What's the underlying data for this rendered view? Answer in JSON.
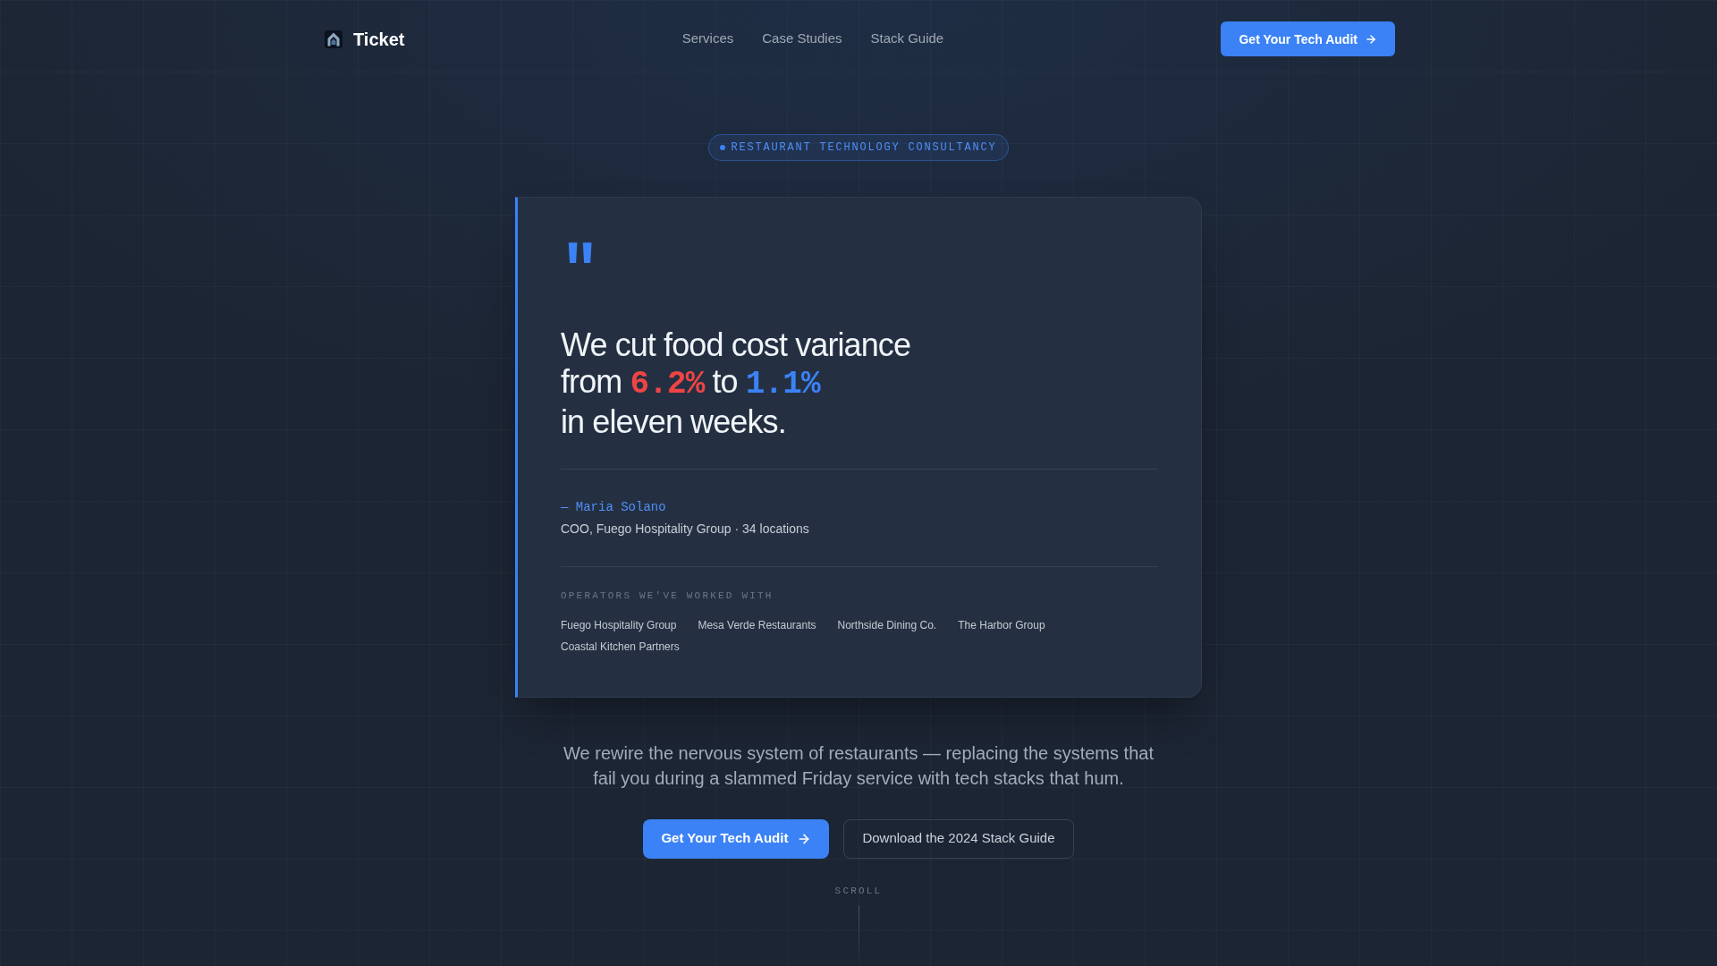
{
  "header": {
    "logo_text": "Ticket",
    "nav": [
      "Services",
      "Case Studies",
      "Stack Guide"
    ],
    "cta": "Get Your Tech Audit"
  },
  "badge": "RESTAURANT TECHNOLOGY CONSULTANCY",
  "testimonial": {
    "quote_mark": "\"",
    "headline": [
      [
        {
          "kind": "text",
          "text": "We cut food cost variance"
        }
      ],
      [
        {
          "kind": "text",
          "text": "from "
        },
        {
          "kind": "stat",
          "text": "6.2%",
          "color": "#ef4444"
        },
        {
          "kind": "text",
          "text": " to "
        },
        {
          "kind": "stat",
          "text": "1.1%",
          "color": "#3b82f6"
        }
      ],
      [
        {
          "kind": "text",
          "text": "in eleven weeks."
        }
      ]
    ],
    "author": "— Maria Solano",
    "attribution": "COO, Fuego Hospitality Group · 34 locations",
    "operators_label": "OPERATORS WE'VE WORKED WITH",
    "operators": [
      "Fuego Hospitality Group",
      "Mesa Verde Restaurants",
      "Northside Dining Co.",
      "The Harbor Group",
      "Coastal Kitchen Partners"
    ]
  },
  "intro": "We rewire the nervous system of restaurants — replacing the systems that fail you during a slammed Friday service with tech stacks that hum.",
  "actions": [
    {
      "kind": "primary",
      "label": "Get Your Tech Audit"
    },
    {
      "kind": "secondary",
      "label": "Download the 2024 Stack Guide"
    }
  ],
  "scroll_hint": "SCROLL"
}
